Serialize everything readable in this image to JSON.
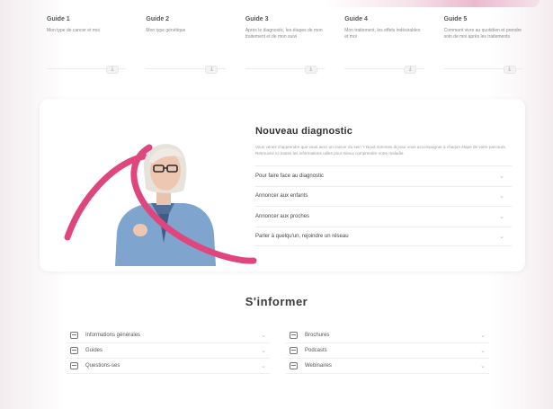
{
  "guides": [
    {
      "title": "Guide 1",
      "desc": "Mon type de cancer et moi",
      "download_icon": "download-icon"
    },
    {
      "title": "Guide 2",
      "desc": "Mon type génétique",
      "download_icon": "download-icon"
    },
    {
      "title": "Guide 3",
      "desc": "Après le diagnostic, les étapes de mon traitement et de mon suivi",
      "download_icon": "download-icon"
    },
    {
      "title": "Guide 4",
      "desc": "Mon traitement, les effets indésirables et moi",
      "download_icon": "download-icon"
    },
    {
      "title": "Guide 5",
      "desc": "Comment vivre au quotidien et prendre soin de moi après les traitements",
      "download_icon": "download-icon"
    }
  ],
  "diagnostic": {
    "title": "Nouveau diagnostic",
    "text": "Vous venez d'apprendre que vous avez un cancer du sein ? Nous sommes là pour vous accompagner à chaque étape de votre parcours. Retrouvez ici toutes les informations utiles pour mieux comprendre votre maladie.",
    "items": [
      {
        "label": "Pour faire face au diagnostic"
      },
      {
        "label": "Annoncer aux enfants"
      },
      {
        "label": "Annoncer aux proches"
      },
      {
        "label": "Parler à quelqu'un, rejoindre un réseau"
      }
    ],
    "accent_color": "#e0467e"
  },
  "inform": {
    "title": "S'informer",
    "left": [
      {
        "label": "Informations générales"
      },
      {
        "label": "Guides"
      },
      {
        "label": "Questions-ses"
      }
    ],
    "right": [
      {
        "label": "Brochures"
      },
      {
        "label": "Podcasts"
      },
      {
        "label": "Webinaires"
      }
    ]
  }
}
